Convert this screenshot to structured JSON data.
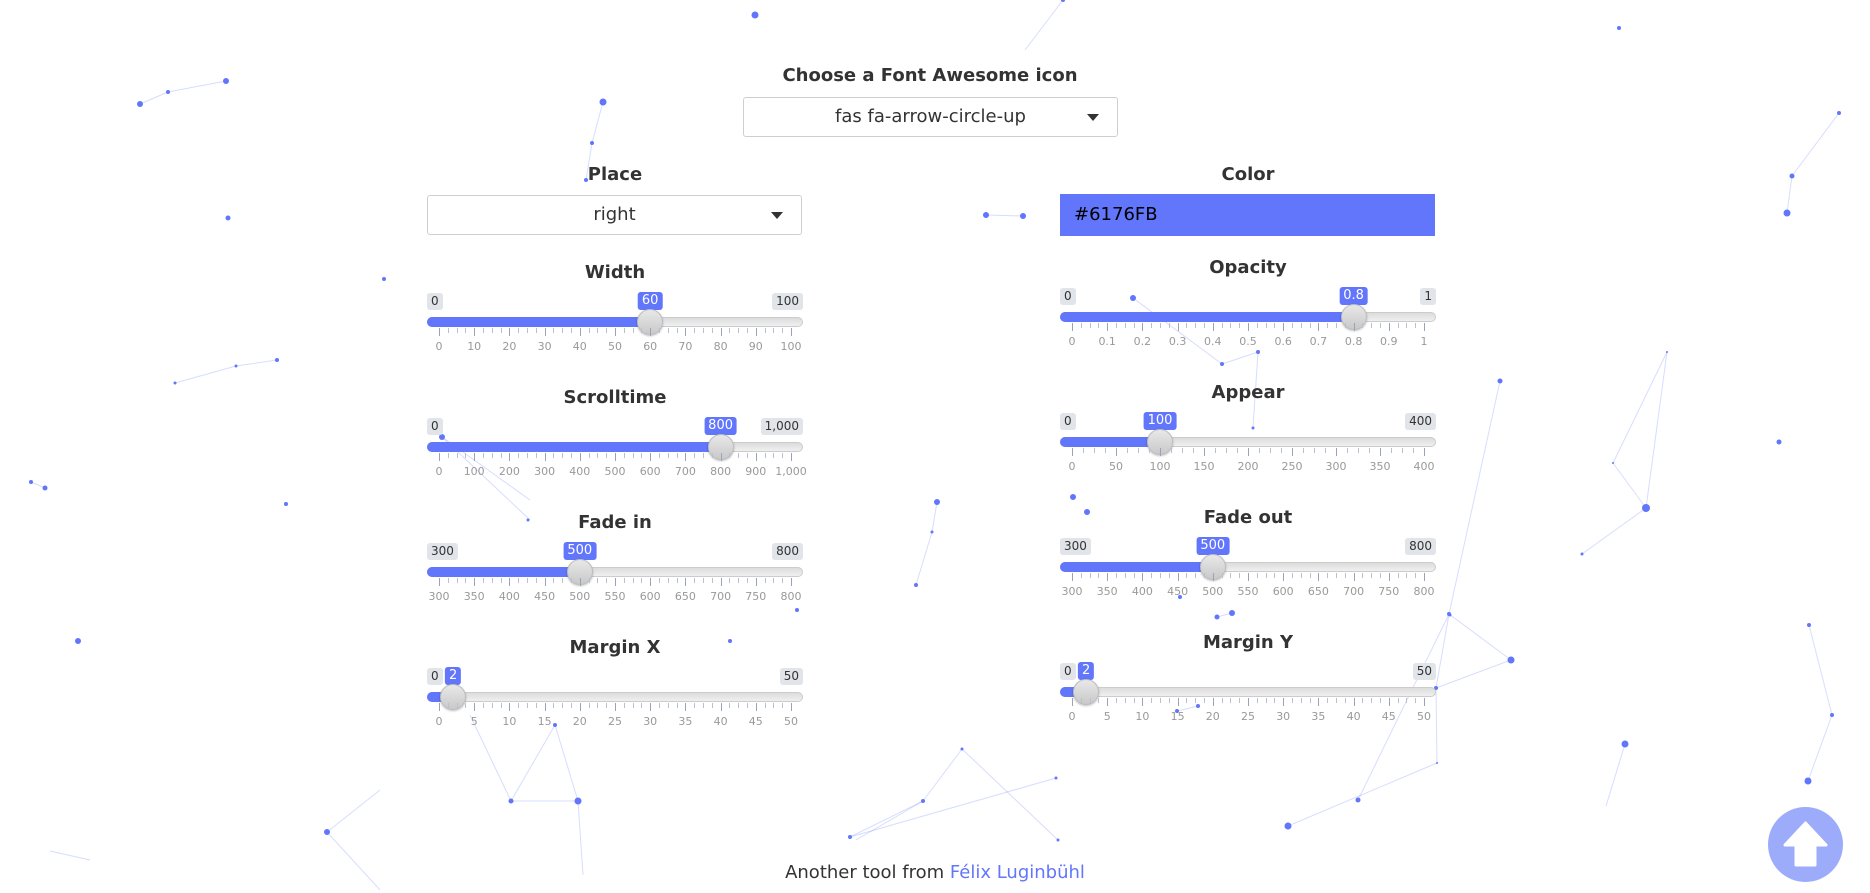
{
  "icon_chooser": {
    "label": "Choose a Font Awesome icon",
    "value": "fas fa-arrow-circle-up"
  },
  "place": {
    "label": "Place",
    "value": "right"
  },
  "color": {
    "label": "Color",
    "value": "#6176FB"
  },
  "sliders": {
    "width": {
      "label": "Width",
      "min": 0,
      "max": 100,
      "min_label": "0",
      "max_label": "100",
      "value": 60,
      "value_label": "60",
      "ticks": [
        "0",
        "10",
        "20",
        "30",
        "40",
        "50",
        "60",
        "70",
        "80",
        "90",
        "100"
      ]
    },
    "scrolltime": {
      "label": "Scrolltime",
      "min": 0,
      "max": 1000,
      "min_label": "0",
      "max_label": "1,000",
      "value": 800,
      "value_label": "800",
      "ticks": [
        "0",
        "100",
        "200",
        "300",
        "400",
        "500",
        "600",
        "700",
        "800",
        "900",
        "1,000"
      ]
    },
    "fadein": {
      "label": "Fade in",
      "min": 300,
      "max": 800,
      "min_label": "300",
      "max_label": "800",
      "value": 500,
      "value_label": "500",
      "ticks": [
        "300",
        "350",
        "400",
        "450",
        "500",
        "550",
        "600",
        "650",
        "700",
        "750",
        "800"
      ]
    },
    "marginx": {
      "label": "Margin X",
      "min": 0,
      "max": 50,
      "min_label": "0",
      "max_label": "50",
      "value": 2,
      "value_label": "2",
      "ticks": [
        "0",
        "5",
        "10",
        "15",
        "20",
        "25",
        "30",
        "35",
        "40",
        "45",
        "50"
      ]
    },
    "opacity": {
      "label": "Opacity",
      "min": 0,
      "max": 1,
      "min_label": "0",
      "max_label": "1",
      "value": 0.8,
      "value_label": "0.8",
      "ticks": [
        "0",
        "0.1",
        "0.2",
        "0.3",
        "0.4",
        "0.5",
        "0.6",
        "0.7",
        "0.8",
        "0.9",
        "1"
      ]
    },
    "appear": {
      "label": "Appear",
      "min": 0,
      "max": 400,
      "min_label": "0",
      "max_label": "400",
      "value": 100,
      "value_label": "100",
      "ticks": [
        "0",
        "50",
        "100",
        "150",
        "200",
        "250",
        "300",
        "350",
        "400"
      ]
    },
    "fadeout": {
      "label": "Fade out",
      "min": 300,
      "max": 800,
      "min_label": "300",
      "max_label": "800",
      "value": 500,
      "value_label": "500",
      "ticks": [
        "300",
        "350",
        "400",
        "450",
        "500",
        "550",
        "600",
        "650",
        "700",
        "750",
        "800"
      ]
    },
    "marginy": {
      "label": "Margin Y",
      "min": 0,
      "max": 50,
      "min_label": "0",
      "max_label": "50",
      "value": 2,
      "value_label": "2",
      "ticks": [
        "0",
        "5",
        "10",
        "15",
        "20",
        "25",
        "30",
        "35",
        "40",
        "45",
        "50"
      ]
    }
  },
  "footer": {
    "text": "Another tool from ",
    "link": "Félix Luginbühl"
  },
  "scroll_top_button": {
    "icon": "arrow-circle-up-icon",
    "color": "#6176FB",
    "opacity": 0.6
  },
  "colors": {
    "accent": "#6176FB",
    "particles": "#6176FB"
  }
}
